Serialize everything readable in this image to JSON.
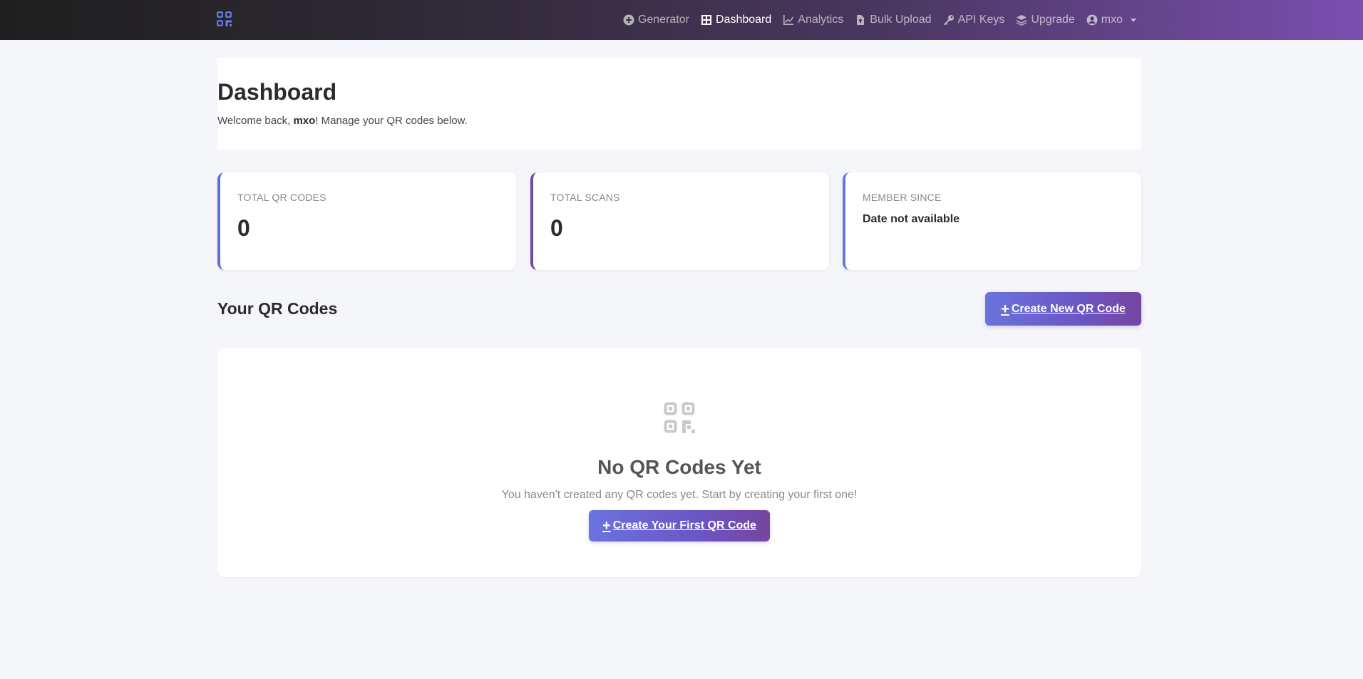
{
  "navbar": {
    "brand_icon": "qr-code-icon",
    "items": [
      {
        "label": "Generator",
        "icon": "plus-circle-icon"
      },
      {
        "label": "Dashboard",
        "icon": "grid-icon",
        "active": true
      },
      {
        "label": "Analytics",
        "icon": "line-chart-icon"
      },
      {
        "label": "Bulk Upload",
        "icon": "file-upload-icon"
      },
      {
        "label": "API Keys",
        "icon": "key-icon"
      },
      {
        "label": "Upgrade",
        "icon": "layers-icon"
      },
      {
        "label": "mxo",
        "icon": "user-circle-icon",
        "dropdown": true
      }
    ]
  },
  "header": {
    "title": "Dashboard",
    "welcome_prefix": "Welcome back, ",
    "username": "mxo",
    "welcome_suffix": "! Manage your QR codes below."
  },
  "stats": [
    {
      "label": "TOTAL QR CODES",
      "value": "0"
    },
    {
      "label": "TOTAL SCANS",
      "value": "0"
    },
    {
      "label": "MEMBER SINCE",
      "value": "Date not available"
    }
  ],
  "qr_section": {
    "title": "Your QR Codes",
    "create_button": "Create New QR Code"
  },
  "empty_state": {
    "icon": "qr-code-icon",
    "title": "No QR Codes Yet",
    "description": "You haven't created any QR codes yet. Start by creating your first one!",
    "button": "Create Your First QR Code"
  },
  "colors": {
    "accent_blue": "#6170d8",
    "accent_purple": "#7047a6",
    "nav_gradient_end": "#7a4fb0",
    "background": "#f5f6fa"
  }
}
